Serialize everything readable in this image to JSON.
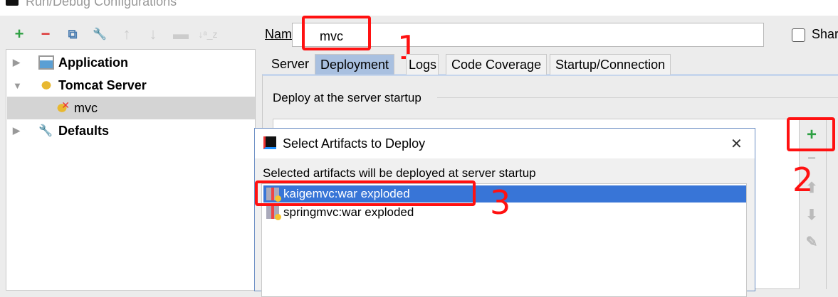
{
  "window": {
    "title": "Run/Debug Configurations"
  },
  "toolbar": {
    "add": "+",
    "remove": "−",
    "copy": "⧉",
    "edit_defaults": "🔧",
    "move_up": "↑",
    "move_down": "↓",
    "folder": "▬",
    "sort": "↓ᵃ_z"
  },
  "tree": [
    {
      "label": "Application",
      "expanded": false
    },
    {
      "label": "Tomcat Server",
      "expanded": true
    },
    {
      "label": "mvc",
      "selected": true
    },
    {
      "label": "Defaults",
      "expanded": false
    }
  ],
  "name_label": "Name",
  "name_value": "mvc",
  "share_label": "Shar",
  "tabs": [
    "Server",
    "Deployment",
    "Logs",
    "Code Coverage",
    "Startup/Connection"
  ],
  "active_tab": "Deployment",
  "deploy_label": "Deploy at the server startup",
  "side_buttons": {
    "add": "+",
    "remove": "−",
    "up": "⬆",
    "down": "⬇",
    "edit": "✎"
  },
  "annotations": [
    "1",
    "2",
    "3"
  ],
  "dialog": {
    "title": "Select Artifacts to Deploy",
    "close": "✕",
    "label": "Selected artifacts will be deployed at server startup",
    "artifacts": [
      {
        "label": "kaigemvc:war exploded",
        "selected": true
      },
      {
        "label": "springmvc:war exploded",
        "selected": false
      }
    ]
  },
  "colors": {
    "selection": "#3875d7",
    "annotation": "#ff1111",
    "add_green": "#2ea043"
  }
}
